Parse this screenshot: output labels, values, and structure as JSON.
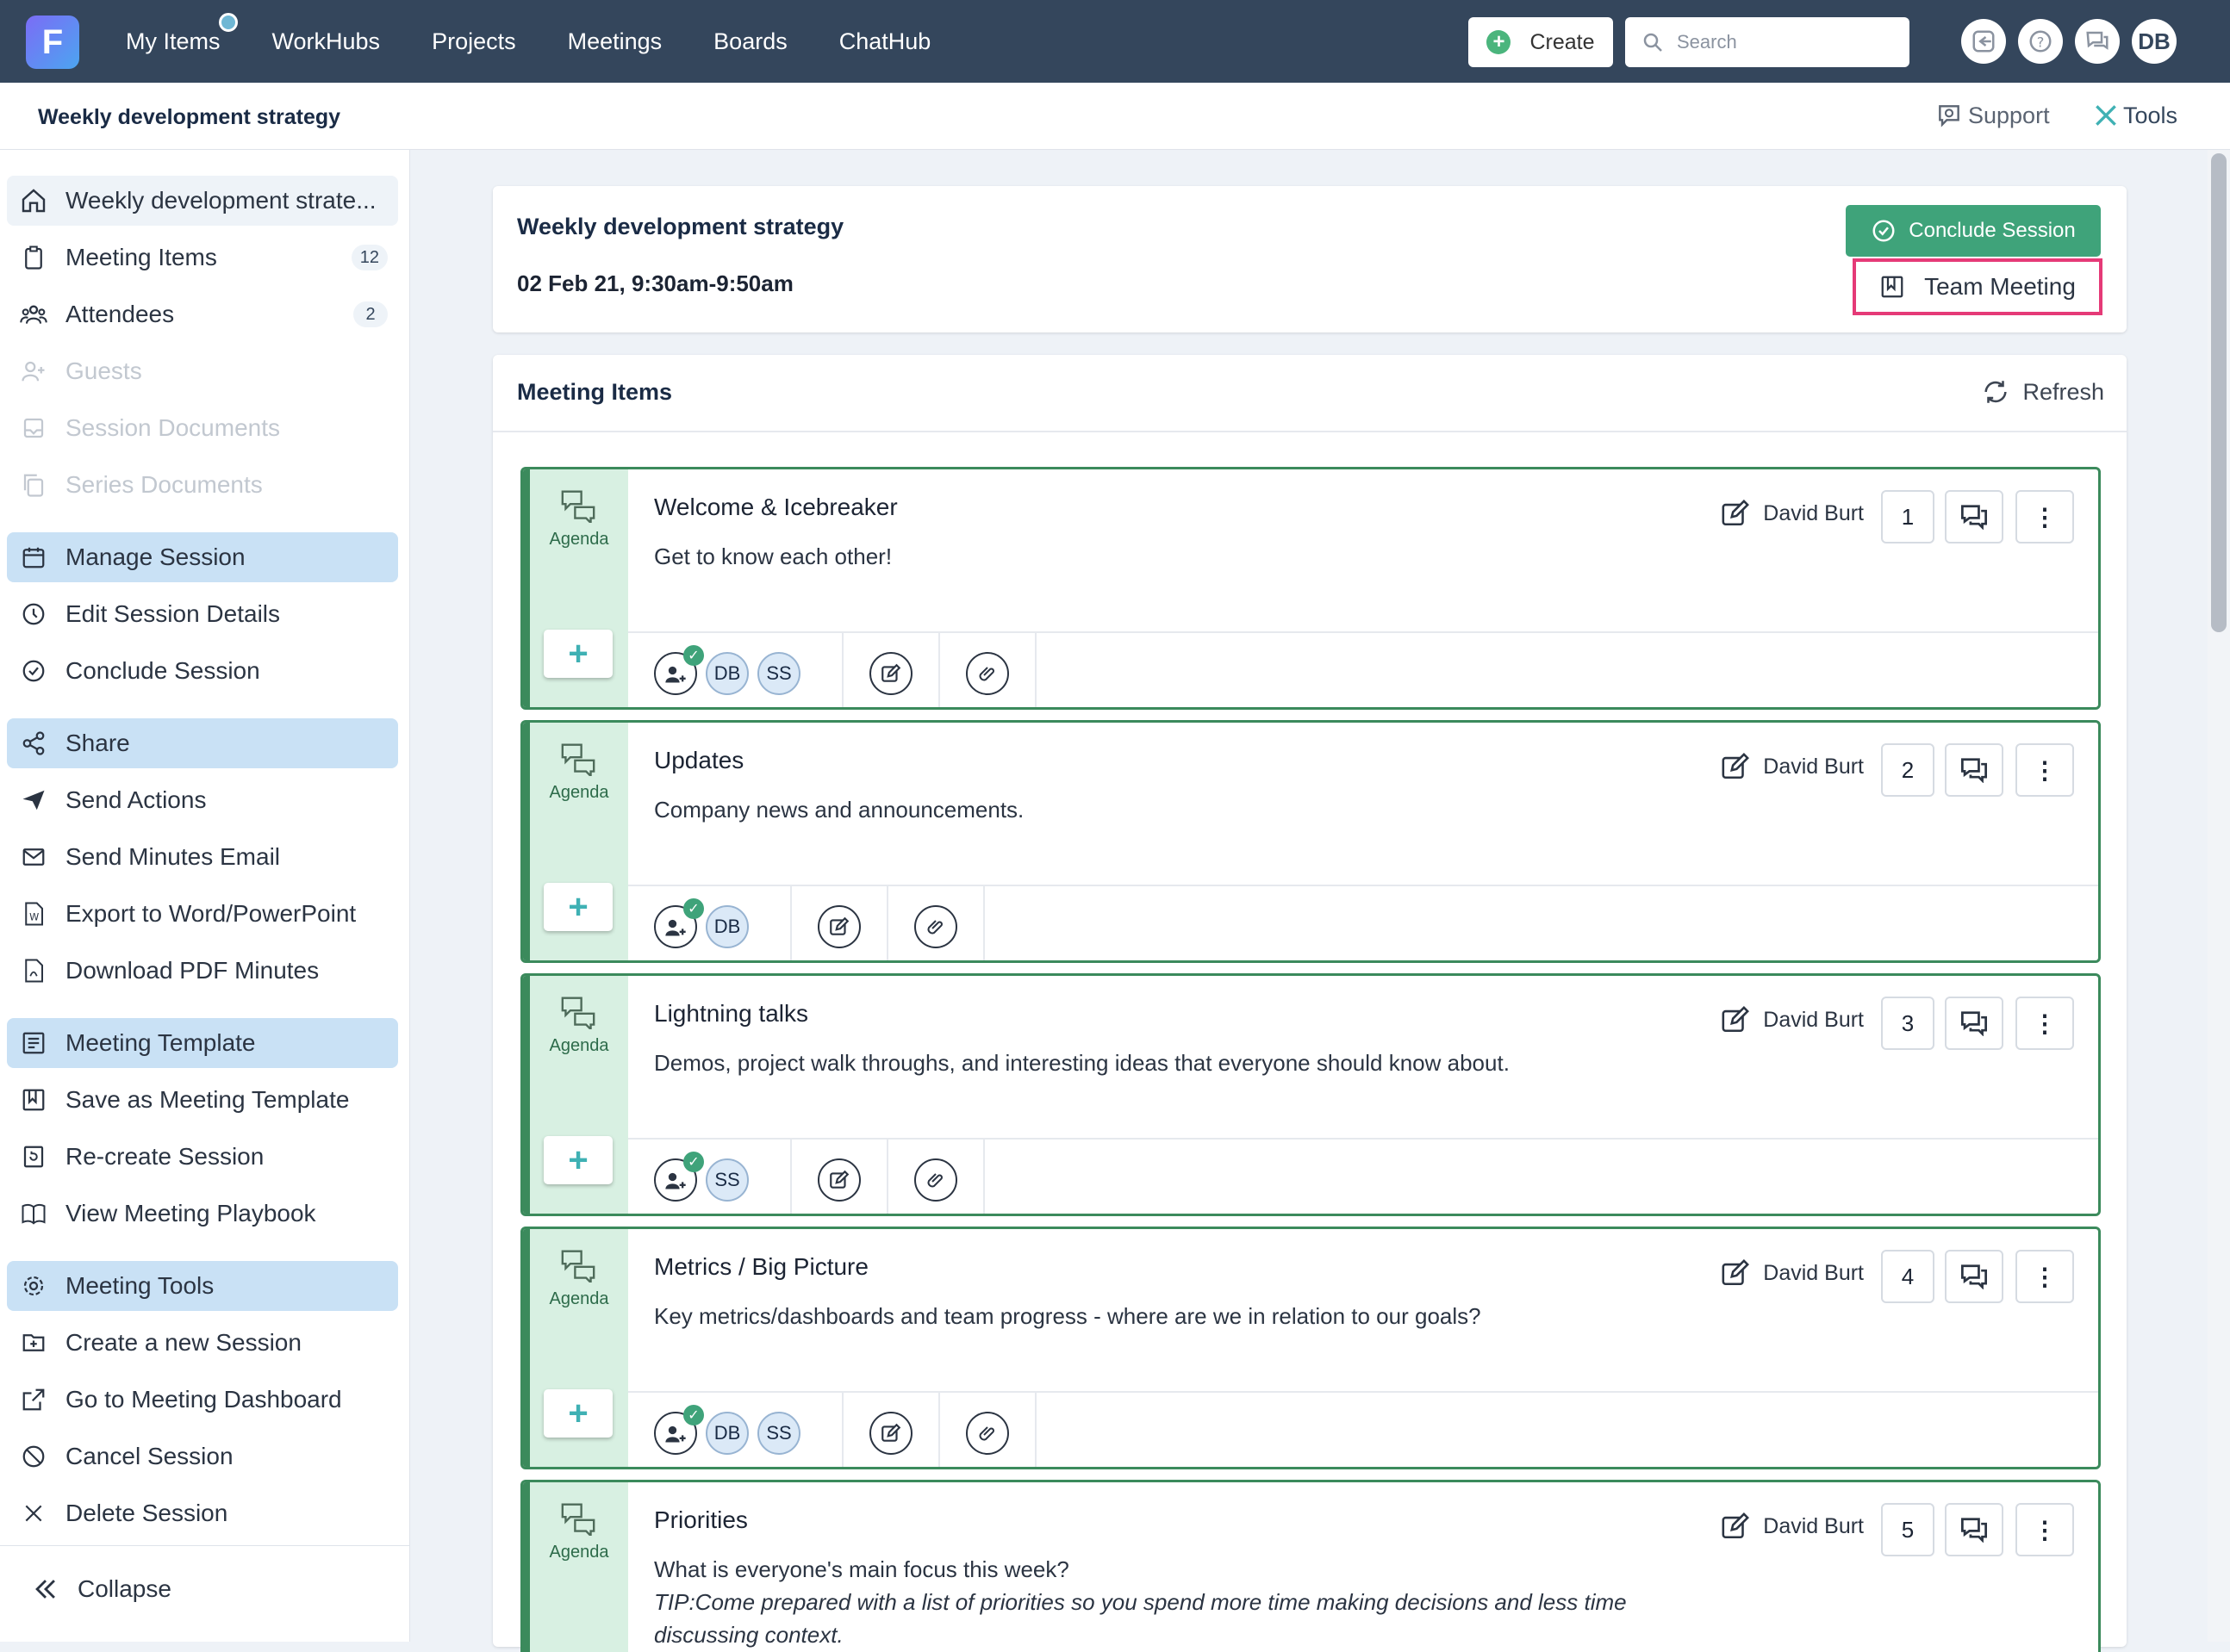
{
  "topbar": {
    "nav": [
      "My Items",
      "WorkHubs",
      "Projects",
      "Meetings",
      "Boards",
      "ChatHub"
    ],
    "create_label": "Create",
    "search_placeholder": "Search",
    "user_initials": "DB"
  },
  "subbar": {
    "breadcrumb": "Weekly development strategy",
    "support_label": "Support",
    "tools_label": "Tools"
  },
  "sidebar": {
    "items": [
      {
        "label": "Weekly development strate...",
        "icon": "home-icon"
      },
      {
        "label": "Meeting Items",
        "badge": "12",
        "icon": "clipboard-icon"
      },
      {
        "label": "Attendees",
        "badge": "2",
        "icon": "users-icon"
      },
      {
        "label": "Guests",
        "icon": "add-user-icon"
      },
      {
        "label": "Session Documents",
        "icon": "document-icon"
      },
      {
        "label": "Series Documents",
        "icon": "copy-icon"
      },
      {
        "label": "Manage Session",
        "icon": "calendar-icon"
      },
      {
        "label": "Edit Session Details",
        "icon": "clock-icon"
      },
      {
        "label": "Conclude Session",
        "icon": "check-circle-icon"
      },
      {
        "label": "Share",
        "icon": "share-icon"
      },
      {
        "label": "Send Actions",
        "icon": "send-icon"
      },
      {
        "label": "Send Minutes Email",
        "icon": "mail-icon"
      },
      {
        "label": "Export to Word/PowerPoint",
        "icon": "word-icon"
      },
      {
        "label": "Download PDF Minutes",
        "icon": "pdf-icon"
      },
      {
        "label": "Meeting Template",
        "icon": "template-icon"
      },
      {
        "label": "Save as Meeting Template",
        "icon": "bookmark-icon"
      },
      {
        "label": "Re-create Session",
        "icon": "recreate-icon"
      },
      {
        "label": "View Meeting Playbook",
        "icon": "book-icon"
      },
      {
        "label": "Meeting Tools",
        "icon": "gear-icon"
      },
      {
        "label": "Create a new Session",
        "icon": "new-session-icon"
      },
      {
        "label": "Go to Meeting Dashboard",
        "icon": "external-link-icon"
      },
      {
        "label": "Cancel Session",
        "icon": "cancel-icon"
      },
      {
        "label": "Delete Session",
        "icon": "close-icon"
      }
    ],
    "collapse_label": "Collapse"
  },
  "session": {
    "title": "Weekly development strategy",
    "date": "02 Feb 21, 9:30am-9:50am",
    "conclude_label": "Conclude Session",
    "team_meeting_label": "Team Meeting"
  },
  "meeting_items": {
    "header": "Meeting Items",
    "refresh_label": "Refresh",
    "agenda_label": "Agenda",
    "items": [
      {
        "title": "Welcome & Icebreaker",
        "desc": "Get to know each other!",
        "owner": "David Burt",
        "num": "1",
        "attendees": [
          "DB",
          "SS"
        ]
      },
      {
        "title": "Updates",
        "desc": "Company news and announcements.",
        "owner": "David Burt",
        "num": "2",
        "attendees": [
          "DB"
        ]
      },
      {
        "title": "Lightning talks",
        "desc": "Demos, project walk throughs, and interesting ideas that everyone should know about.",
        "owner": "David Burt",
        "num": "3",
        "attendees": [
          "SS"
        ]
      },
      {
        "title": "Metrics / Big Picture",
        "desc": "Key metrics/dashboards and team progress - where are we in relation to our goals?",
        "owner": "David Burt",
        "num": "4",
        "attendees": [
          "DB",
          "SS"
        ]
      },
      {
        "title": "Priorities",
        "desc": "What is everyone's main focus this week?",
        "tip": "TIP:Come prepared with a list of priorities so you spend more time making decisions and less time discussing context.",
        "owner": "David Burt",
        "num": "5",
        "attendees": []
      }
    ]
  },
  "colors": {
    "topbar": "#34465c",
    "accent_green": "#3fa37a",
    "item_border": "#3b8a5c",
    "highlight_box": "#e53a77",
    "active_sidebar": "#c9e1f5"
  }
}
